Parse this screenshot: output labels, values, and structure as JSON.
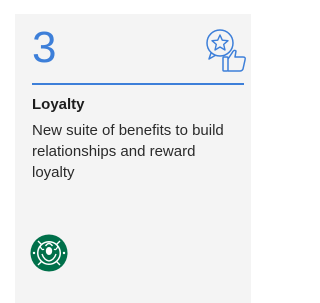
{
  "card": {
    "number": "3",
    "title": "Loyalty",
    "description": "New suite of benefits to build relationships and reward loyalty",
    "icon": "star-thumbs-up-icon",
    "logo": "starbucks-logo",
    "accent_color": "#3d7fd9"
  }
}
